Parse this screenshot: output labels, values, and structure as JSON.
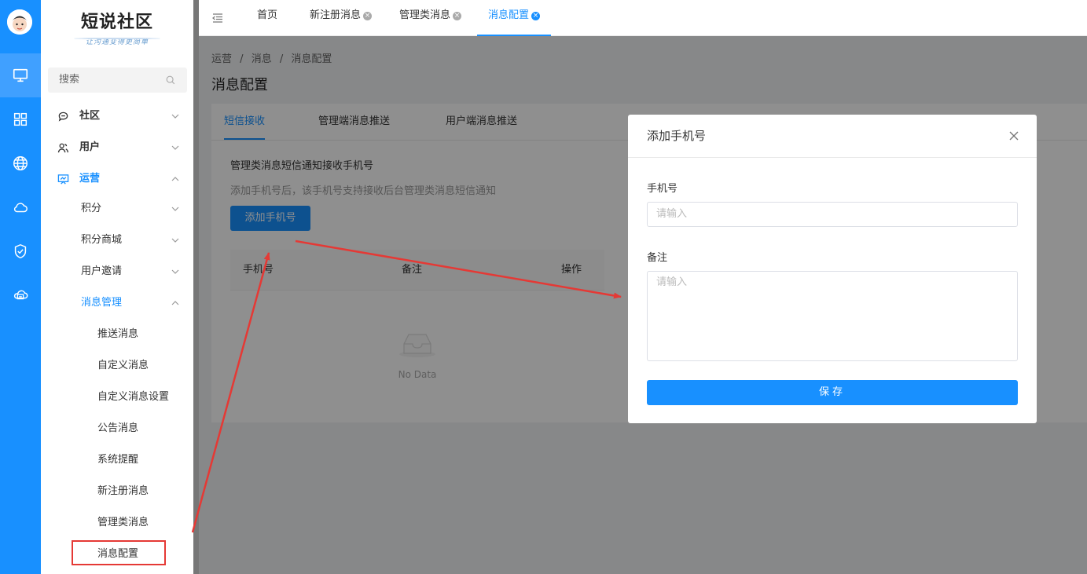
{
  "logo": {
    "title": "短说社区",
    "subtitle": "让沟通变得更简单"
  },
  "search": {
    "placeholder": "搜索"
  },
  "sidebar": {
    "items": [
      {
        "label": "社区"
      },
      {
        "label": "用户"
      },
      {
        "label": "运营"
      },
      {
        "label": "积分"
      },
      {
        "label": "积分商城"
      },
      {
        "label": "用户邀请"
      },
      {
        "label": "消息管理"
      },
      {
        "label": "推送消息"
      },
      {
        "label": "自定义消息"
      },
      {
        "label": "自定义消息设置"
      },
      {
        "label": "公告消息"
      },
      {
        "label": "系统提醒"
      },
      {
        "label": "新注册消息"
      },
      {
        "label": "管理类消息"
      },
      {
        "label": "消息配置"
      }
    ]
  },
  "topTabs": [
    {
      "label": "首页"
    },
    {
      "label": "新注册消息"
    },
    {
      "label": "管理类消息"
    },
    {
      "label": "消息配置"
    }
  ],
  "breadcrumb": {
    "l1": "运营",
    "l2": "消息",
    "l3": "消息配置",
    "sep": "/"
  },
  "page": {
    "title": "消息配置"
  },
  "contentTabs": [
    {
      "label": "短信接收"
    },
    {
      "label": "管理端消息推送"
    },
    {
      "label": "用户端消息推送"
    }
  ],
  "section": {
    "title": "管理类消息短信通知接收手机号",
    "desc": "添加手机号后，该手机号支持接收后台管理类消息短信通知",
    "add_button": "添加手机号"
  },
  "table": {
    "columns": [
      "手机号",
      "备注",
      "操作"
    ],
    "empty_text": "No Data"
  },
  "dialog": {
    "title": "添加手机号",
    "phone_label": "手机号",
    "phone_placeholder": "请输入",
    "note_label": "备注",
    "note_placeholder": "请输入",
    "save_label": "保存"
  },
  "colors": {
    "primary": "#1890ff",
    "annotation": "#e53935"
  }
}
